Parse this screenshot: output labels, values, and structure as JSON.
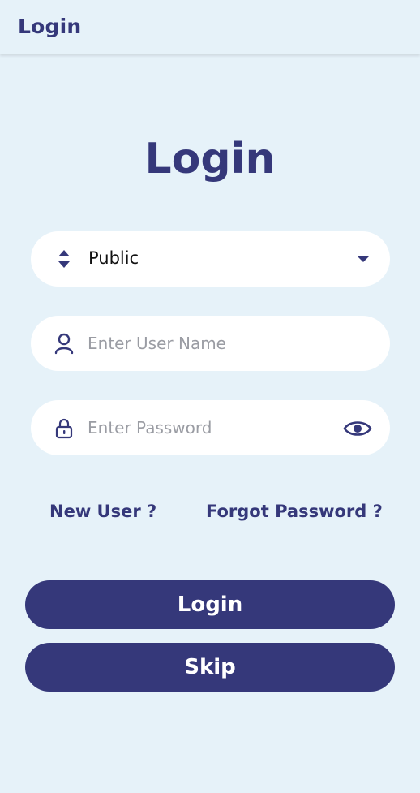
{
  "app_bar": {
    "title": "Login"
  },
  "heading": "Login",
  "user_type_select": {
    "selected": "Public",
    "icon": "sort-arrows-icon",
    "dropdown_icon": "caret-down-icon"
  },
  "username_field": {
    "placeholder": "Enter User Name",
    "value": "",
    "icon": "person-icon"
  },
  "password_field": {
    "placeholder": "Enter Password",
    "value": "",
    "icon": "lock-icon",
    "toggle_icon": "eye-icon"
  },
  "links": {
    "new_user": "New User ?",
    "forgot_password": "Forgot Password ?"
  },
  "buttons": {
    "login": "Login",
    "skip": "Skip"
  },
  "colors": {
    "background": "#e6f2f9",
    "primary": "#35387a",
    "field_bg": "#ffffff",
    "placeholder": "#9a9ca3"
  }
}
